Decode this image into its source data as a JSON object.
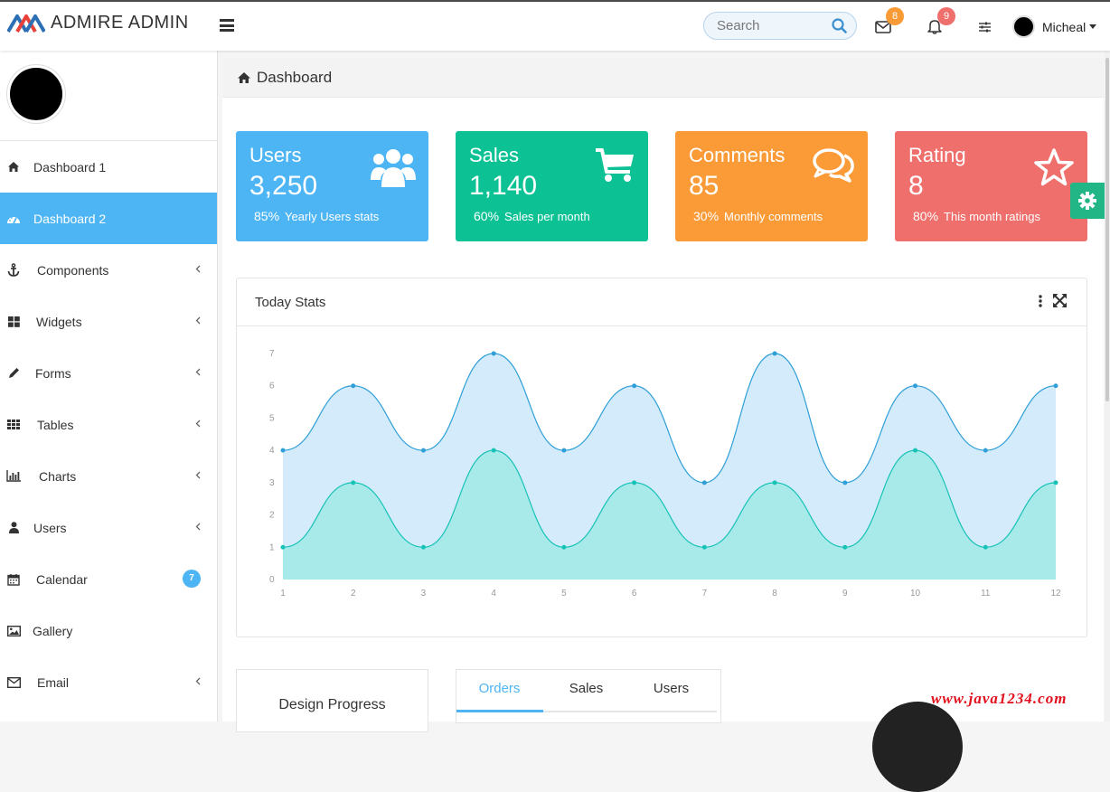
{
  "brand": {
    "name": "ADMIRE ADMIN"
  },
  "header": {
    "search_placeholder": "Search",
    "mail_count": "8",
    "notification_count": "9",
    "user_name": "Micheal",
    "colors": {
      "mail_badge": "#f89a35",
      "notification_badge": "#ef6f6c"
    }
  },
  "sidebar": {
    "items": [
      {
        "label": "Dashboard 1",
        "icon": "home-icon"
      },
      {
        "label": "Dashboard 2",
        "icon": "dashboard-icon",
        "active": true
      },
      {
        "label": "Components",
        "icon": "anchor-icon",
        "submenu": true
      },
      {
        "label": "Widgets",
        "icon": "grid-icon",
        "submenu": true
      },
      {
        "label": "Forms",
        "icon": "pencil-icon",
        "submenu": true
      },
      {
        "label": "Tables",
        "icon": "table-icon",
        "submenu": true
      },
      {
        "label": "Charts",
        "icon": "bar-chart-icon",
        "submenu": true
      },
      {
        "label": "Users",
        "icon": "user-icon",
        "submenu": true
      },
      {
        "label": "Calendar",
        "icon": "calendar-icon",
        "badge": "7"
      },
      {
        "label": "Gallery",
        "icon": "image-icon"
      },
      {
        "label": "Email",
        "icon": "envelope-icon",
        "submenu": true
      }
    ],
    "active_color": "#4eb5f5"
  },
  "breadcrumb": {
    "title": "Dashboard"
  },
  "stats": [
    {
      "title": "Users",
      "value": "3,250",
      "percent": "85%",
      "caption": "Yearly Users stats",
      "color": "#4eb5f5",
      "icon": "users-icon"
    },
    {
      "title": "Sales",
      "value": "1,140",
      "percent": "60%",
      "caption": "Sales per month",
      "color": "#0cc295",
      "icon": "cart-icon"
    },
    {
      "title": "Comments",
      "value": "85",
      "percent": "30%",
      "caption": "Monthly comments",
      "color": "#fb9b37",
      "icon": "comments-icon"
    },
    {
      "title": "Rating",
      "value": "8",
      "percent": "80%",
      "caption": "This month ratings",
      "color": "#ef6f6c",
      "icon": "star-icon"
    }
  ],
  "panel": {
    "title": "Today Stats"
  },
  "chart_data": {
    "type": "area",
    "title": "Today Stats",
    "x": [
      1,
      2,
      3,
      4,
      5,
      6,
      7,
      8,
      9,
      10,
      11,
      12
    ],
    "series": [
      {
        "values": [
          4,
          6,
          4,
          7,
          4,
          6,
          3,
          7,
          3,
          6,
          4,
          6
        ],
        "color": "#2f9fd8",
        "fill": "#d3ebfa"
      },
      {
        "values": [
          1,
          3,
          1,
          4,
          1,
          3,
          1,
          3,
          1,
          4,
          1,
          3
        ],
        "color": "#17c2b6",
        "fill": "#a8eaea"
      }
    ],
    "ylim": [
      0,
      7
    ],
    "yticks": [
      0,
      1,
      2,
      3,
      4,
      5,
      6,
      7
    ],
    "grid": false,
    "xlabel": "",
    "ylabel": ""
  },
  "design_progress": {
    "title": "Design Progress"
  },
  "tabs": [
    {
      "label": "Orders",
      "active": true
    },
    {
      "label": "Sales"
    },
    {
      "label": "Users"
    }
  ],
  "watermark": "www.java1234.com"
}
